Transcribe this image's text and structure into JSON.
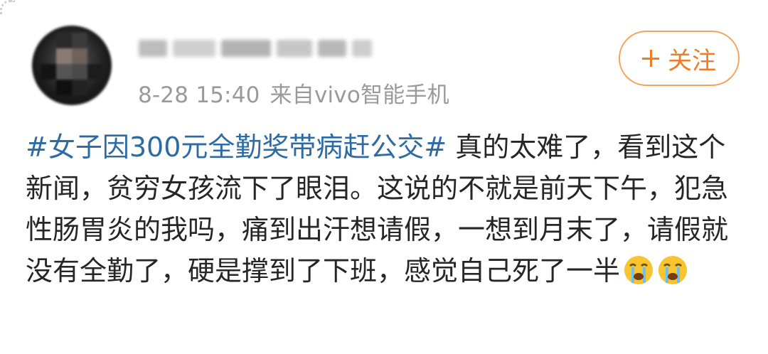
{
  "post": {
    "username": "",
    "timestamp": "8-28 15:40",
    "source": "来自vivo智能手机",
    "follow_label": "关注",
    "hashtag": "#女子因300元全勤奖带病赶公交#",
    "body": " 真的太难了，看到这个新闻，贫穷女孩流下了眼泪。这说的不就是前天下午，犯急性肠胃炎的我吗，痛到出汗想请假，一想到月末了，请假就没有全勤了，硬是撑到了下班，感觉自己死了一半",
    "emojis": [
      "crying-face-icon",
      "crying-face-icon"
    ]
  },
  "colors": {
    "hashtag": "#2d6ba5",
    "follow_accent": "#f07c28",
    "meta_text": "#9a9a9a",
    "body_text": "#262626"
  }
}
